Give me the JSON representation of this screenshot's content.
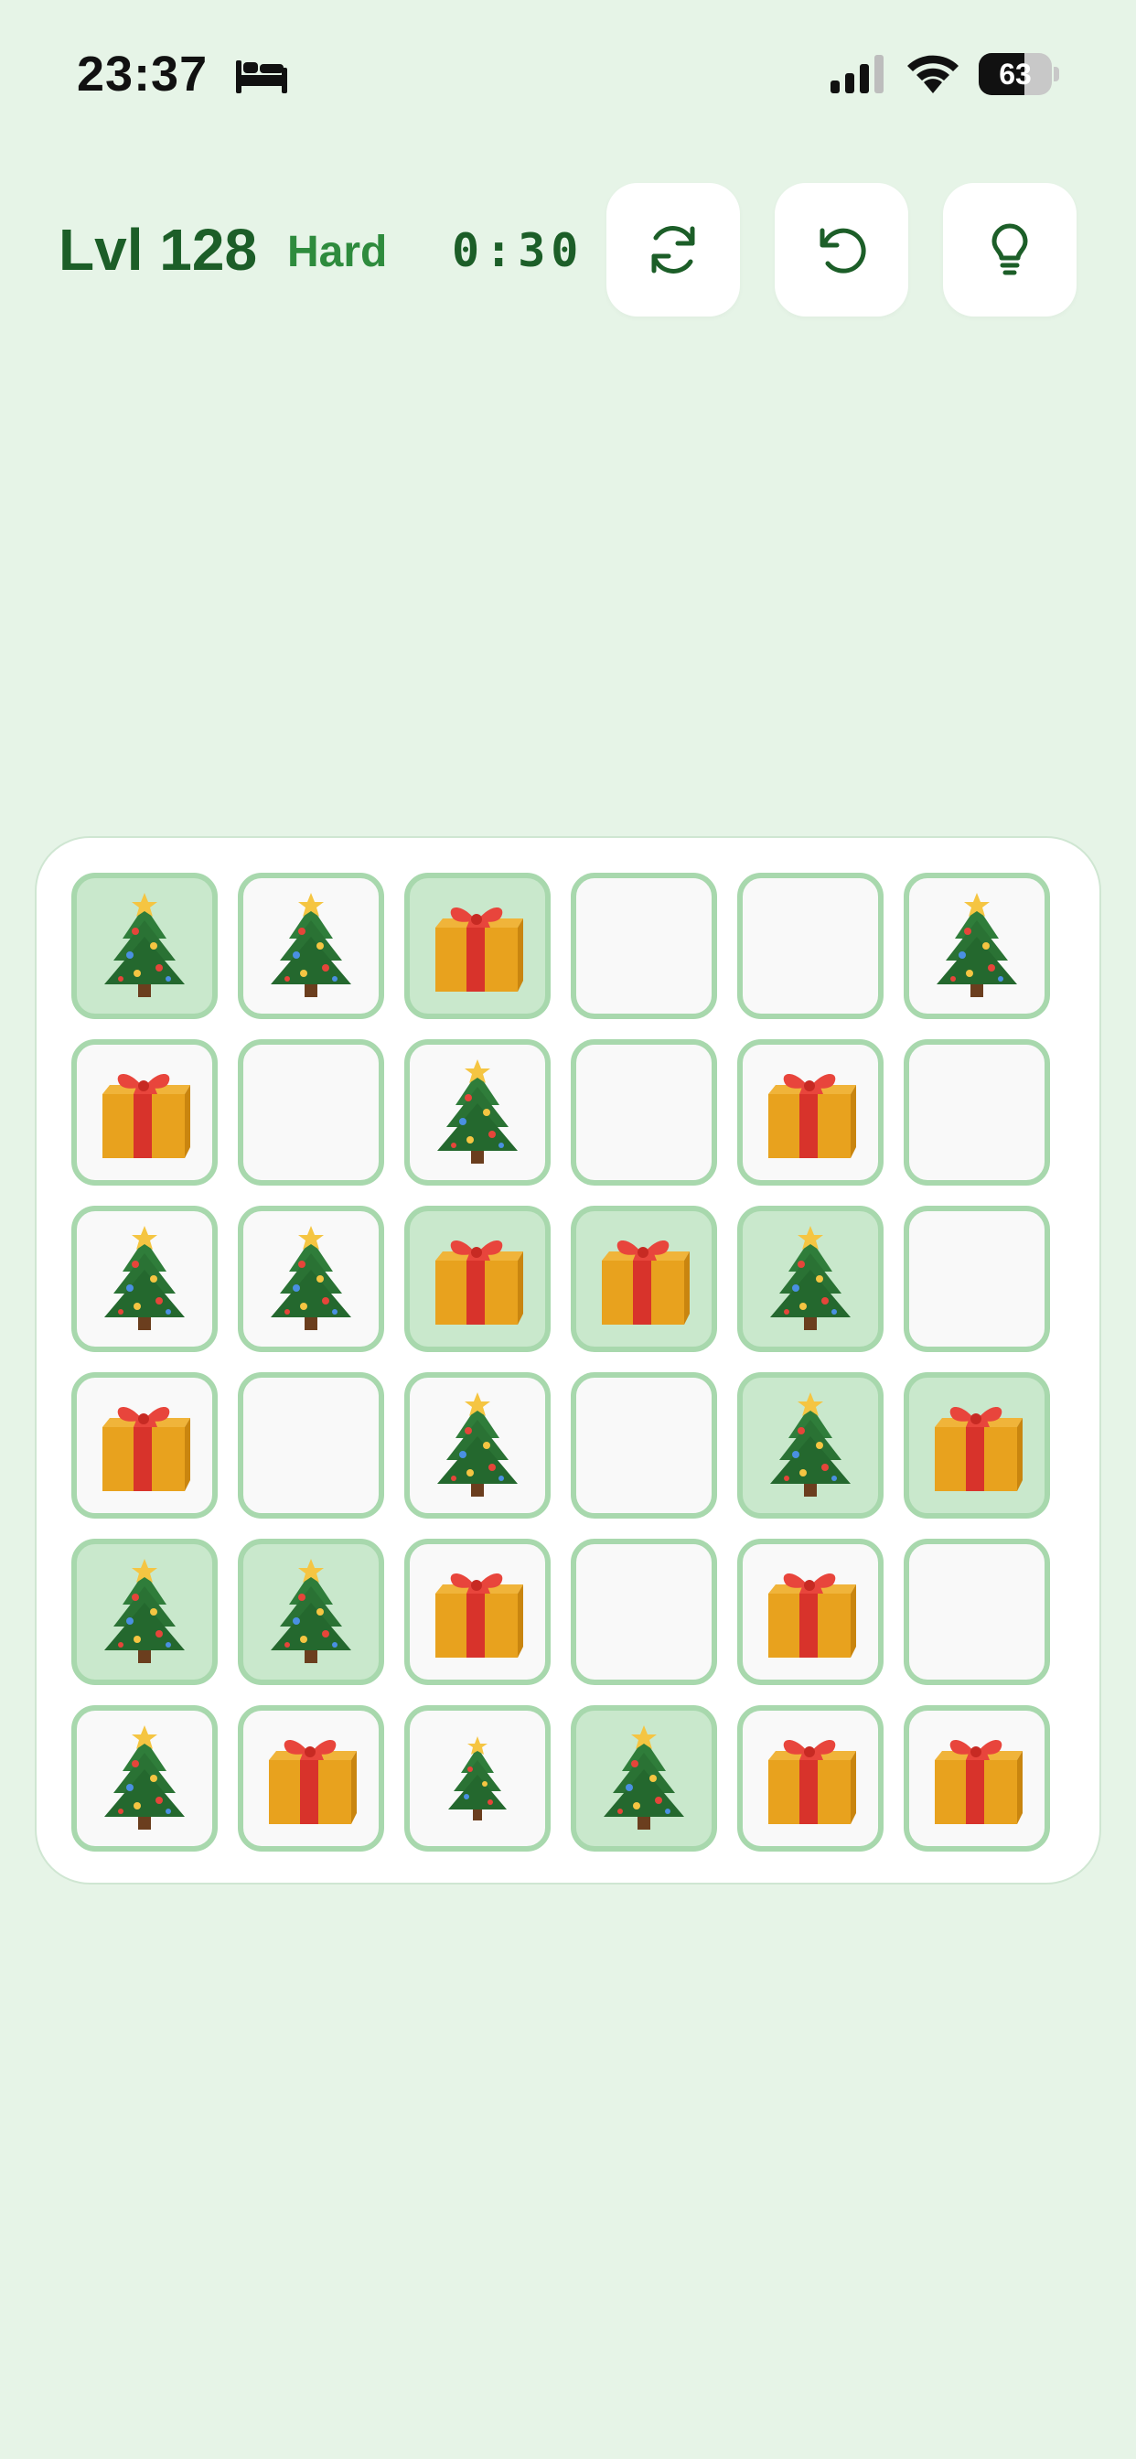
{
  "status_bar": {
    "time": "23:37",
    "battery": 63,
    "icons": [
      "bed-icon",
      "signal-icon",
      "wifi-icon",
      "battery-icon"
    ]
  },
  "header": {
    "level": "Lvl 128",
    "difficulty": "Hard",
    "timer": "0:30",
    "buttons": [
      {
        "name": "restart-button",
        "icon": "refresh-icon"
      },
      {
        "name": "undo-button",
        "icon": "undo-icon"
      },
      {
        "name": "hint-button",
        "icon": "lightbulb-icon"
      }
    ]
  },
  "board": {
    "rows": 6,
    "cols": 6,
    "cells": [
      [
        {
          "p": "tree",
          "hl": true
        },
        {
          "p": "tree",
          "hl": false
        },
        {
          "p": "gift",
          "hl": true
        },
        {
          "p": "",
          "hl": false
        },
        {
          "p": "",
          "hl": false
        },
        {
          "p": "tree",
          "hl": false
        }
      ],
      [
        {
          "p": "gift",
          "hl": false
        },
        {
          "p": "",
          "hl": false
        },
        {
          "p": "tree",
          "hl": false
        },
        {
          "p": "",
          "hl": false
        },
        {
          "p": "gift",
          "hl": false
        },
        {
          "p": "",
          "hl": false
        }
      ],
      [
        {
          "p": "tree",
          "hl": false
        },
        {
          "p": "tree",
          "hl": false
        },
        {
          "p": "gift",
          "hl": true
        },
        {
          "p": "gift",
          "hl": true
        },
        {
          "p": "tree",
          "hl": true
        },
        {
          "p": "",
          "hl": false
        }
      ],
      [
        {
          "p": "gift",
          "hl": false
        },
        {
          "p": "",
          "hl": false
        },
        {
          "p": "tree",
          "hl": false
        },
        {
          "p": "",
          "hl": false
        },
        {
          "p": "tree",
          "hl": true
        },
        {
          "p": "gift",
          "hl": true
        }
      ],
      [
        {
          "p": "tree",
          "hl": true
        },
        {
          "p": "tree",
          "hl": true
        },
        {
          "p": "gift",
          "hl": false
        },
        {
          "p": "",
          "hl": false
        },
        {
          "p": "gift",
          "hl": false
        },
        {
          "p": "",
          "hl": false
        }
      ],
      [
        {
          "p": "tree",
          "hl": false
        },
        {
          "p": "gift",
          "hl": false
        },
        {
          "p": "tree-small",
          "hl": false
        },
        {
          "p": "tree",
          "hl": true
        },
        {
          "p": "gift",
          "hl": false
        },
        {
          "p": "gift",
          "hl": false
        }
      ]
    ],
    "piece_icons": {
      "tree": "christmas-tree-icon",
      "tree-small": "christmas-tree-icon",
      "gift": "gift-icon"
    }
  },
  "colors": {
    "background": "#e6f4e7",
    "level_text": "#1c5e28",
    "difficulty_text": "#2e8b3d",
    "cell_border": "#a8d8ad",
    "cell_highlight": "#c9e8cc"
  }
}
